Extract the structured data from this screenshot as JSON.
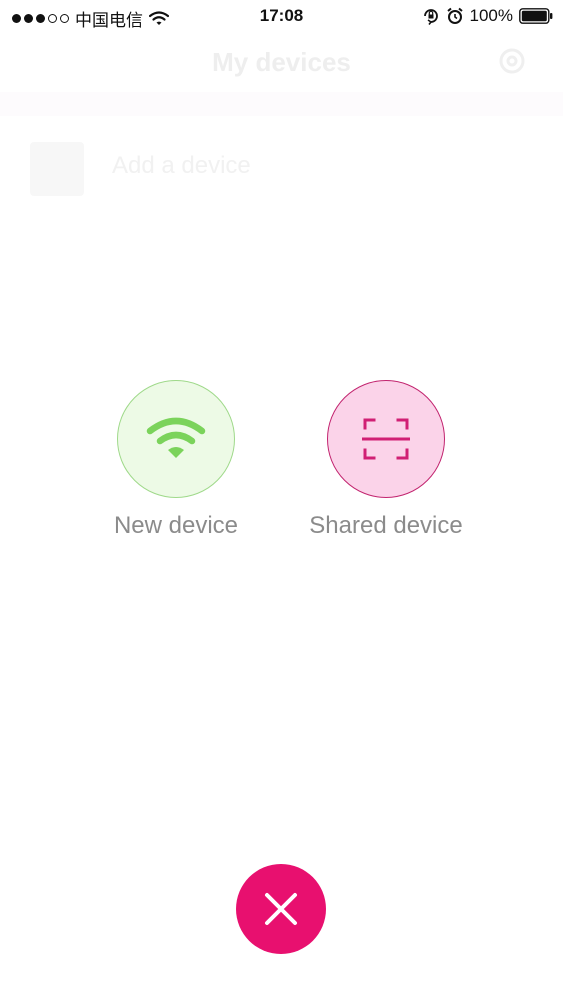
{
  "status_bar": {
    "carrier": "中国电信",
    "time": "17:08",
    "battery": "100%",
    "signal_strength_dots": 3,
    "signal_total_dots": 5,
    "icons": [
      "wifi-icon",
      "orientation-lock-icon",
      "alarm-icon",
      "battery-icon"
    ]
  },
  "nav": {
    "title": "My devices",
    "right_icon": "settings-gear-icon"
  },
  "device_list": {
    "add_label": "Add a device"
  },
  "add_menu": {
    "options": [
      {
        "label": "New device",
        "icon": "wifi-icon",
        "color": "#7bd35b"
      },
      {
        "label": "Shared device",
        "icon": "scan-icon",
        "color": "#d01f74"
      }
    ],
    "close_icon": "close-icon",
    "close_color": "#e8106f"
  }
}
